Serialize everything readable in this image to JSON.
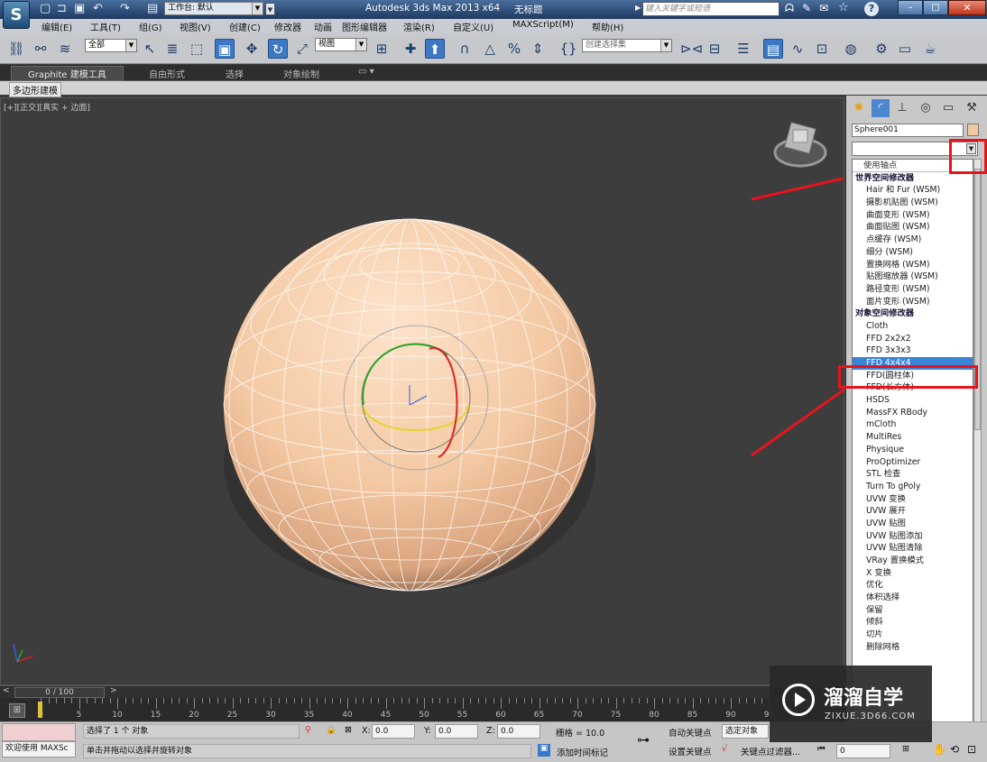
{
  "titlebar": {
    "workspace_label": "工作台: 默认",
    "app_title": "Autodesk 3ds Max  2013 x64",
    "doc_title": "无标题",
    "search_placeholder": "键入关键字或短语"
  },
  "menubar": {
    "items": [
      "编辑(E)",
      "工具(T)",
      "组(G)",
      "视图(V)",
      "创建(C)",
      "修改器",
      "动画",
      "图形编辑器",
      "渲染(R)",
      "自定义(U)",
      "MAXScript(M)",
      "帮助(H)"
    ]
  },
  "toolbar": {
    "filter_value": "全部",
    "coord_value": "视图",
    "selset_value": "创建选择集"
  },
  "ribbon": {
    "tabs": [
      "Graphite 建模工具",
      "自由形式",
      "选择",
      "对象绘制"
    ],
    "sub_label": "多边形建模"
  },
  "viewport": {
    "label": "[+][正交][真实 + 边面]"
  },
  "command_panel": {
    "object_name": "Sphere001",
    "modifier_list": [
      {
        "label": "使用轴点",
        "kind": "top"
      },
      {
        "label": "世界空间修改器",
        "kind": "hdr"
      },
      {
        "label": "Hair 和 Fur (WSM)",
        "kind": "it"
      },
      {
        "label": "摄影机贴图 (WSM)",
        "kind": "it"
      },
      {
        "label": "曲面变形 (WSM)",
        "kind": "it"
      },
      {
        "label": "曲面贴图 (WSM)",
        "kind": "it"
      },
      {
        "label": "点缓存 (WSM)",
        "kind": "it"
      },
      {
        "label": "细分 (WSM)",
        "kind": "it"
      },
      {
        "label": "置换网格 (WSM)",
        "kind": "it"
      },
      {
        "label": "贴图缩放器 (WSM)",
        "kind": "it"
      },
      {
        "label": "路径变形 (WSM)",
        "kind": "it"
      },
      {
        "label": "面片变形 (WSM)",
        "kind": "it"
      },
      {
        "label": "对象空间修改器",
        "kind": "hdr"
      },
      {
        "label": "Cloth",
        "kind": "it"
      },
      {
        "label": "FFD 2x2x2",
        "kind": "it"
      },
      {
        "label": "FFD 3x3x3",
        "kind": "it"
      },
      {
        "label": "FFD 4x4x4",
        "kind": "sel"
      },
      {
        "label": "FFD(圆柱体)",
        "kind": "it"
      },
      {
        "label": "FFD(长方体)",
        "kind": "it"
      },
      {
        "label": "HSDS",
        "kind": "it"
      },
      {
        "label": "MassFX RBody",
        "kind": "it"
      },
      {
        "label": "mCloth",
        "kind": "it"
      },
      {
        "label": "MultiRes",
        "kind": "it"
      },
      {
        "label": "Physique",
        "kind": "it"
      },
      {
        "label": "ProOptimizer",
        "kind": "it"
      },
      {
        "label": "STL 检查",
        "kind": "it"
      },
      {
        "label": "Turn To gPoly",
        "kind": "it"
      },
      {
        "label": "UVW 变换",
        "kind": "it"
      },
      {
        "label": "UVW 展开",
        "kind": "it"
      },
      {
        "label": "UVW 贴图",
        "kind": "it"
      },
      {
        "label": "UVW 贴图添加",
        "kind": "it"
      },
      {
        "label": "UVW 贴图清除",
        "kind": "it"
      },
      {
        "label": "VRay 置换模式",
        "kind": "it"
      },
      {
        "label": "X 变换",
        "kind": "it"
      },
      {
        "label": "优化",
        "kind": "it"
      },
      {
        "label": "体积选择",
        "kind": "it"
      },
      {
        "label": "保留",
        "kind": "it"
      },
      {
        "label": "倾斜",
        "kind": "it"
      },
      {
        "label": "切片",
        "kind": "it"
      },
      {
        "label": "删除网格",
        "kind": "it"
      }
    ]
  },
  "timeline": {
    "frame_label": "0 / 100",
    "ticks": [
      0,
      5,
      10,
      15,
      20,
      25,
      30,
      35,
      40,
      45,
      50,
      55,
      60,
      65,
      70,
      75,
      80,
      85,
      90,
      95
    ]
  },
  "statusbar": {
    "listener_text": "欢迎使用 MAXSc",
    "status_line1": "选择了 1 个 对象",
    "status_line2": "单击并拖动以选择并旋转对象",
    "x_label": "X:",
    "x_value": "0.0",
    "y_label": "Y:",
    "y_value": "0.0",
    "z_label": "Z:",
    "z_value": "0.0",
    "grid_text": "栅格 = 10.0",
    "auto_key": "自动关键点",
    "set_key": "设置关键点",
    "selected_object": "选定对象",
    "key_filter": "关键点过滤器...",
    "add_time_tag": "添加时间标记",
    "frame_value": "0"
  },
  "watermark": {
    "brand_text": "溜溜自学",
    "url_text": "ZIXUE.3D66.COM"
  },
  "colors": {
    "sphere": "#f4c9a3",
    "selection_highlight": "#3a84d8",
    "annotation_arrow": "#e8141b"
  }
}
